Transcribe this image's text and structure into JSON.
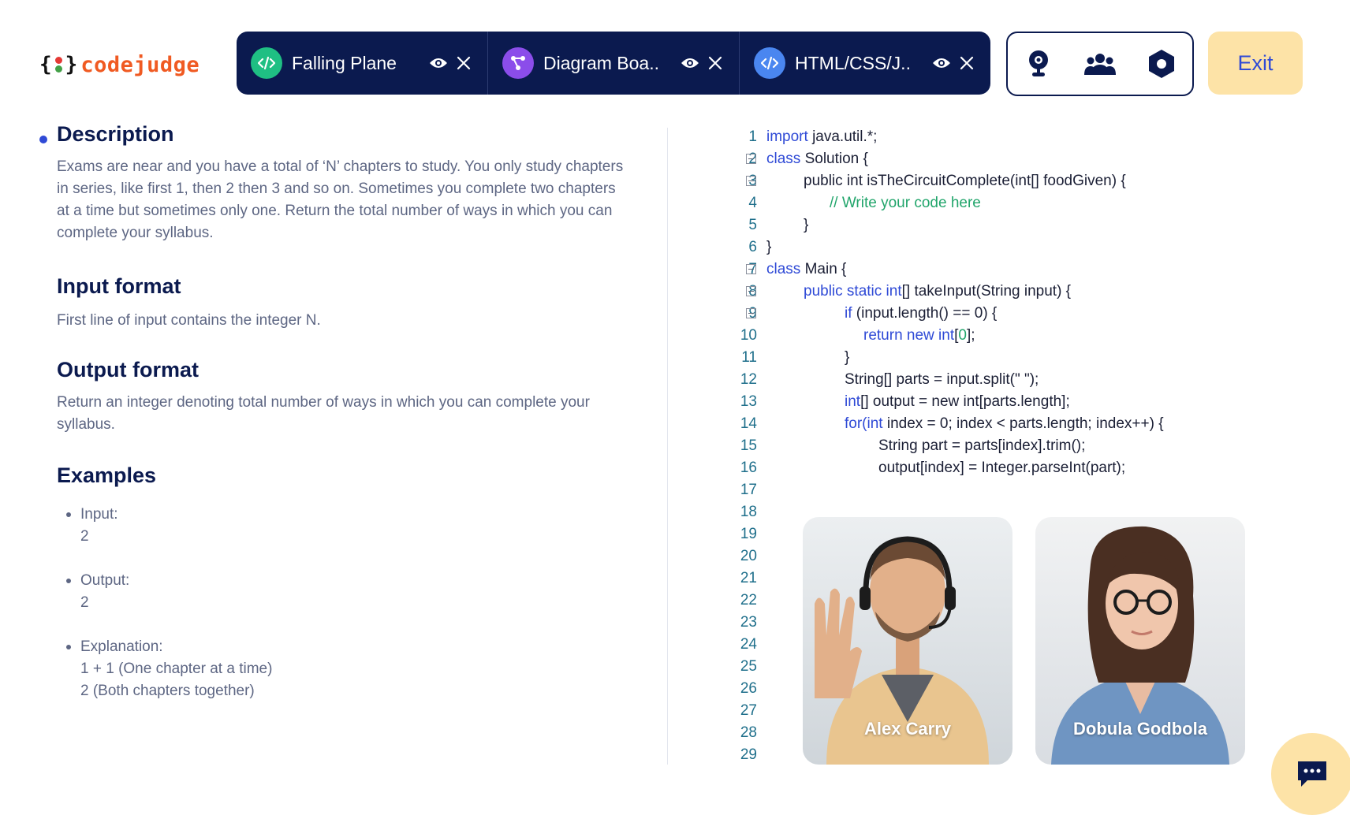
{
  "brand": {
    "name": "codejudge",
    "colors": {
      "primary": "#0b1a4f",
      "accent": "#2f4ad6",
      "logo": "#f05a22",
      "exit_bg": "#fde3a7"
    }
  },
  "tabs": [
    {
      "label": "Falling Plane",
      "icon": "code-icon",
      "icon_color": "#1fbf83"
    },
    {
      "label": "Diagram Boa..",
      "icon": "diagram-icon",
      "icon_color": "#8b4dea"
    },
    {
      "label": "HTML/CSS/J..",
      "icon": "code-icon",
      "icon_color": "#4a86f0"
    }
  ],
  "toolbar": {
    "icons": [
      "webcam-icon",
      "participants-icon",
      "settings-hexagon-icon"
    ]
  },
  "exit_label": "Exit",
  "problem": {
    "description_title": "Description",
    "description": "Exams are near and you have a total of ‘N’ chapters to study. You only study chapters in series, like first 1, then 2 then 3 and so on. Sometimes you complete two chapters at a time but sometimes only one. Return the total number of ways in which you can complete your syllabus.",
    "input_title": "Input format",
    "input_text": "First line of input contains the integer N.",
    "output_title": "Output format",
    "output_text": "Return an integer denoting total number of ways in which you can complete your syllabus.",
    "examples_title": "Examples",
    "examples": {
      "input_label": "Input:",
      "input_value": "2",
      "output_label": "Output:",
      "output_value": "2",
      "explanation_label": "Explanation:",
      "explanation_line1": "1 + 1 (One chapter at a time)",
      "explanation_line2": "2 (Both chapters together)"
    }
  },
  "editor": {
    "line_numbers": [
      "1",
      "2",
      "3",
      "4",
      "5",
      "6",
      "7",
      "8",
      "9",
      "10",
      "11",
      "12",
      "13",
      "14",
      "15",
      "16",
      "17",
      "18",
      "19",
      "20",
      "21",
      "22",
      "23",
      "24",
      "25",
      "26",
      "27",
      "28",
      "29"
    ],
    "lines": [
      "import java.util.*;",
      "class Solution {",
      "public int isTheCircuitComplete(int[] foodGiven) {",
      "// Write your code here",
      "}",
      "}",
      "class Main {",
      "public static int[] takeInput(String input) {",
      "if (input.length() == 0) {",
      "return new int[0];",
      "}",
      "String[] parts = input.split(\" \");",
      "int[] output = new int[parts.length];",
      "for(int index = 0; index < parts.length; index++) {",
      "String part = parts[index].trim();",
      "output[index] = Integer.parseInt(part);"
    ]
  },
  "participants": [
    {
      "name": "Alex Carry"
    },
    {
      "name": "Dobula Godbola"
    }
  ]
}
